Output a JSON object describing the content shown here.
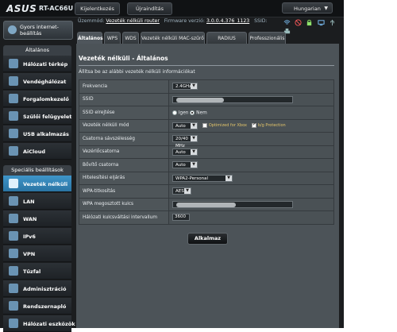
{
  "header": {
    "brand": "ASUS",
    "model": "RT-AC66U",
    "logout_label": "Kijelentkezés",
    "reboot_label": "Újraindítás",
    "language": "Hungarian"
  },
  "status_bar": {
    "mode_label": "Üzemmód:",
    "mode_value": "Vezeték nélküli router",
    "firmware_label": "Firmware verzió:",
    "firmware_value": "3.0.0.4.376_1123",
    "ssid_label": "SSID:"
  },
  "sidebar": {
    "quick_setup": "Gyors internet-beállítás",
    "general_header": "Általános",
    "general_items": [
      {
        "label": "Hálózati térkép",
        "icon": "network-map-icon"
      },
      {
        "label": "Vendéghálózat",
        "icon": "guest-network-icon"
      },
      {
        "label": "Forgalomkezelő",
        "icon": "traffic-manager-icon"
      },
      {
        "label": "Szülői felügyelet",
        "icon": "parental-control-icon"
      },
      {
        "label": "USB alkalmazás",
        "icon": "usb-icon"
      },
      {
        "label": "AiCloud",
        "icon": "cloud-icon"
      }
    ],
    "advanced_header": "Speciális beállítások",
    "advanced_items": [
      {
        "label": "Vezeték nélküli",
        "icon": "wireless-icon",
        "active": true
      },
      {
        "label": "LAN",
        "icon": "lan-icon"
      },
      {
        "label": "WAN",
        "icon": "wan-icon"
      },
      {
        "label": "IPv6",
        "icon": "ipv6-icon"
      },
      {
        "label": "VPN",
        "icon": "vpn-icon"
      },
      {
        "label": "Tűzfal",
        "icon": "firewall-icon"
      },
      {
        "label": "Adminisztráció",
        "icon": "admin-icon"
      },
      {
        "label": "Rendszernapló",
        "icon": "syslog-icon"
      },
      {
        "label": "Hálózati eszközök",
        "icon": "network-tools-icon"
      }
    ]
  },
  "tabs": [
    "Általános",
    "WPS",
    "WDS",
    "Vezeték nélküli MAC-szűrő",
    "RADIUS beállítás",
    "Professzionális"
  ],
  "panel": {
    "title": "Vezeték nélküli - Általános",
    "description": "Állítsa be az alábbi vezeték nélküli információkat"
  },
  "form": {
    "frequency_label": "Frekvencia",
    "frequency_value": "2.4GHz",
    "ssid_label": "SSID",
    "hide_ssid_label": "SSID elrejtése",
    "hide_yes": "Igen",
    "hide_no": "Nem",
    "mode_label": "Vezeték nélküli mód",
    "mode_value": "Auto",
    "xbox_label": "Optimized for Xbox",
    "bg_label": "b/g Protection",
    "bandwidth_label": "Csatorna sávszélesség",
    "bandwidth_value": "20/40 MHz",
    "channel_label": "Vezérlőcsatorna",
    "channel_value": "Auto",
    "ext_channel_label": "Bővítő csatorna",
    "ext_channel_value": "Auto",
    "auth_label": "Hitelesítési eljárás",
    "auth_value": "WPA2-Personal",
    "encryption_label": "WPA-titkosítás",
    "encryption_value": "AES",
    "psk_label": "WPA megosztott kulcs",
    "rotation_label": "Hálózati kulcsváltási intervallum",
    "rotation_value": "3600"
  },
  "apply_label": "Alkalmaz",
  "colors": {
    "active_blue": "#3f95c9",
    "frame": "#1b1d1f",
    "panel": "#4c5358"
  }
}
